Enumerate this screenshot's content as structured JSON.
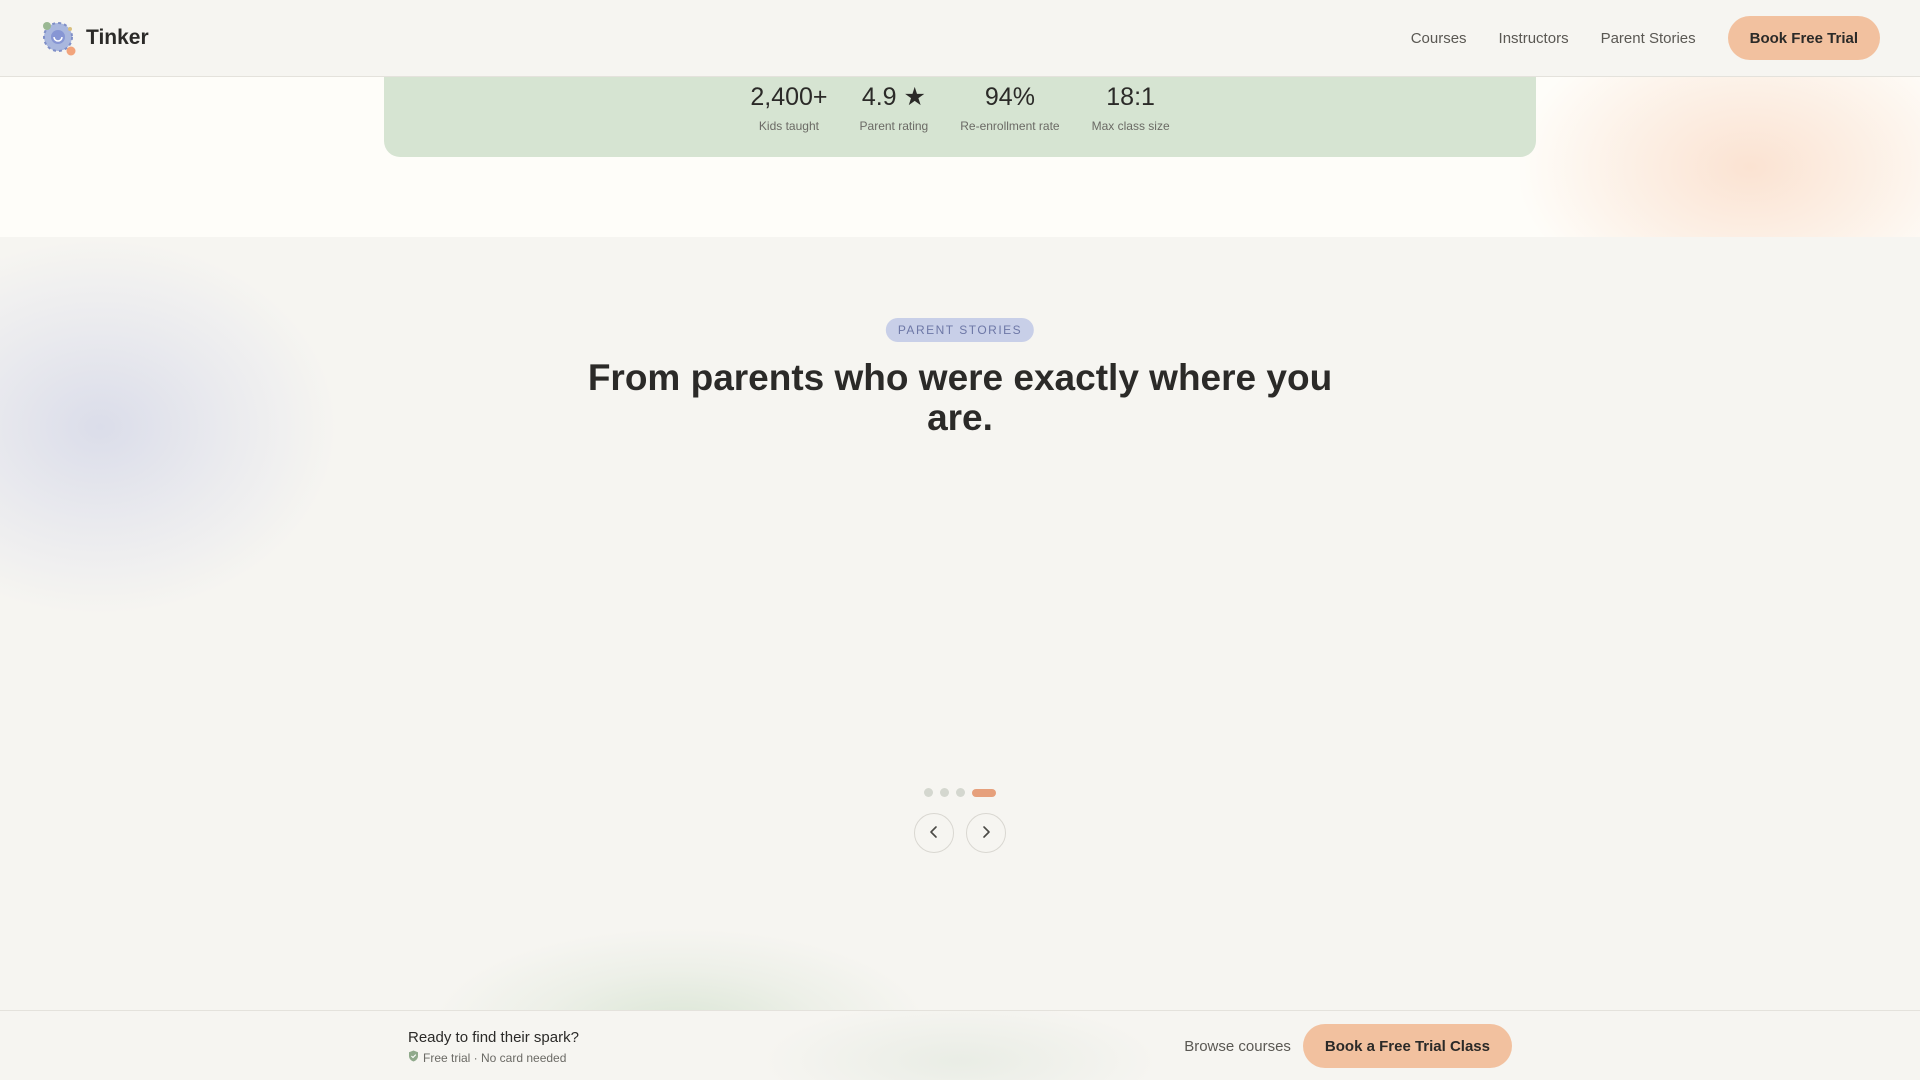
{
  "header": {
    "brand": "Tinker",
    "nav": [
      "Courses",
      "Instructors",
      "Parent Stories"
    ],
    "cta": "Book Free Trial"
  },
  "stats": [
    {
      "value": "2,400+",
      "label": "Kids taught"
    },
    {
      "value": "4.9 ★",
      "label": "Parent rating"
    },
    {
      "value": "94%",
      "label": "Re-enrollment rate"
    },
    {
      "value": "18:1",
      "label": "Max class size"
    }
  ],
  "stories": {
    "eyebrow": "PARENT STORIES",
    "heading": "From parents who were exactly where you are.",
    "carousel": {
      "total": 4,
      "active_index": 4
    }
  },
  "cta_bar": {
    "title": "Ready to find their spark?",
    "subtitle": "Free trial · No card needed",
    "browse": "Browse courses",
    "button": "Book a Free Trial Class"
  },
  "colors": {
    "accent": "#f2c19f",
    "stats_bg": "#d6e4d2",
    "eyebrow_bg": "#c8cfe8",
    "active_dot": "#e6a07c"
  },
  "icons": {
    "logo": "tinker-logo-icon",
    "prev": "chevron-left-icon",
    "next": "chevron-right-icon",
    "shield": "shield-check-icon"
  }
}
